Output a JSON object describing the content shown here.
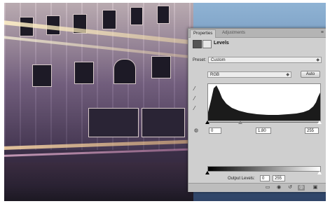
{
  "panel": {
    "tabs": [
      {
        "label": "Properties",
        "active": true
      },
      {
        "label": "Adjustments",
        "active": false
      }
    ],
    "title": "Levels",
    "preset": {
      "label": "Preset:",
      "value": "Custom"
    },
    "channel": {
      "value": "RGB"
    },
    "auto_button": "Auto",
    "input_levels": {
      "black": "0",
      "midtone": "1.80",
      "white": "255"
    },
    "output_levels": {
      "label": "Output Levels:",
      "black": "0",
      "white": "255"
    },
    "footer_icons": [
      "clip-to-layer-icon",
      "view-previous-icon",
      "reset-icon",
      "visibility-icon",
      "delete-icon"
    ]
  }
}
